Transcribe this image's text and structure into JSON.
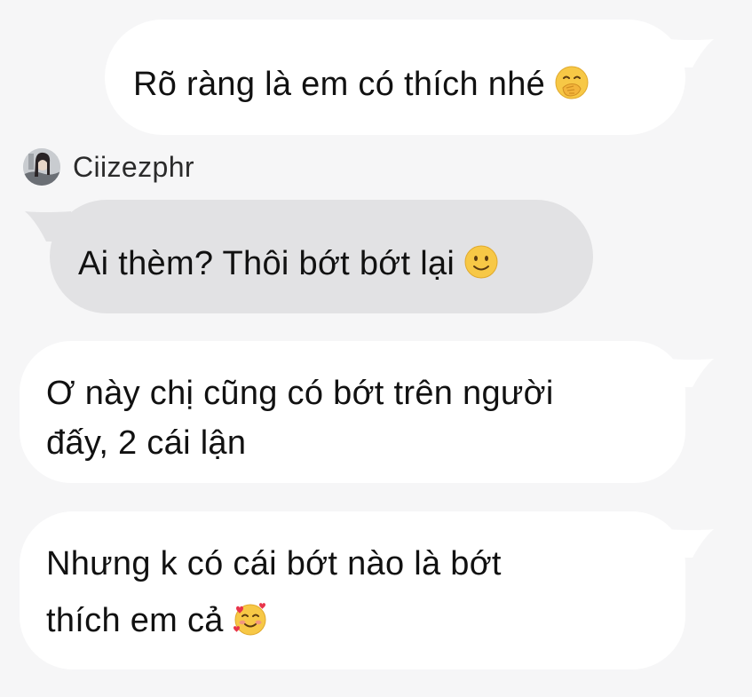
{
  "messages": [
    {
      "id": "m1",
      "direction": "outgoing",
      "text": "Rõ ràng là em có thích nhé",
      "emoji": "hand-over-mouth-emoji"
    },
    {
      "id": "m2",
      "direction": "incoming",
      "sender": "Ciizezphr",
      "text": "Ai thèm? Thôi bớt bớt lại",
      "emoji": "slightly-smiling-face-emoji"
    },
    {
      "id": "m3",
      "direction": "outgoing",
      "text_line1": "Ơ này chị cũng có bớt trên người",
      "text_line2": "đấy, 2 cái lận"
    },
    {
      "id": "m4",
      "direction": "outgoing",
      "text_line1": "Nhưng k có cái bớt nào là bớt",
      "text_line2": "thích em cả",
      "emoji": "smiling-face-with-hearts-emoji"
    }
  ],
  "colors": {
    "background": "#f6f6f7",
    "outgoing_bubble": "#ffffff",
    "incoming_bubble": "#e2e2e4",
    "text": "#111111"
  }
}
